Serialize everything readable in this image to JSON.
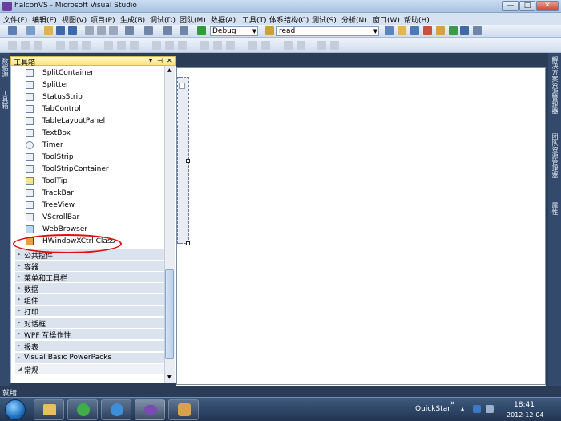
{
  "window": {
    "title": "halconVS - Microsoft Visual Studio",
    "min": "—",
    "max": "□",
    "close": "✕"
  },
  "menu": [
    "文件(F)",
    "编辑(E)",
    "视图(V)",
    "项目(P)",
    "生成(B)",
    "调试(D)",
    "团队(M)",
    "数据(A)",
    "工具(T)",
    "体系结构(C)",
    "测试(S)",
    "分析(N)",
    "窗口(W)",
    "帮助(H)"
  ],
  "toolbar": {
    "config_combo": "Debug",
    "search_combo": "read"
  },
  "left_strip": {
    "tab1": "数据源",
    "tab2": "工具箱"
  },
  "toolbox": {
    "title": "工具箱",
    "items": [
      "SplitContainer",
      "Splitter",
      "StatusStrip",
      "TabControl",
      "TableLayoutPanel",
      "TextBox",
      "Timer",
      "ToolStrip",
      "ToolStripContainer",
      "ToolTip",
      "TrackBar",
      "TreeView",
      "VScrollBar",
      "WebBrowser",
      "HWindowXCtrl Class"
    ],
    "groups": [
      "公共控件",
      "容器",
      "菜单和工具栏",
      "数据",
      "组件",
      "打印",
      "对话框",
      "WPF 互操作性",
      "报表",
      "Visual Basic PowerPacks",
      "常规"
    ]
  },
  "right_strip": {
    "tab1": "解决方案资源管理器",
    "tab2": "团队资源管理器",
    "tab3": "属性"
  },
  "status": {
    "text": "就绪"
  },
  "taskbar": {
    "quickstar": "QuickStar",
    "time": "18:41",
    "date": "2012-12-04"
  }
}
